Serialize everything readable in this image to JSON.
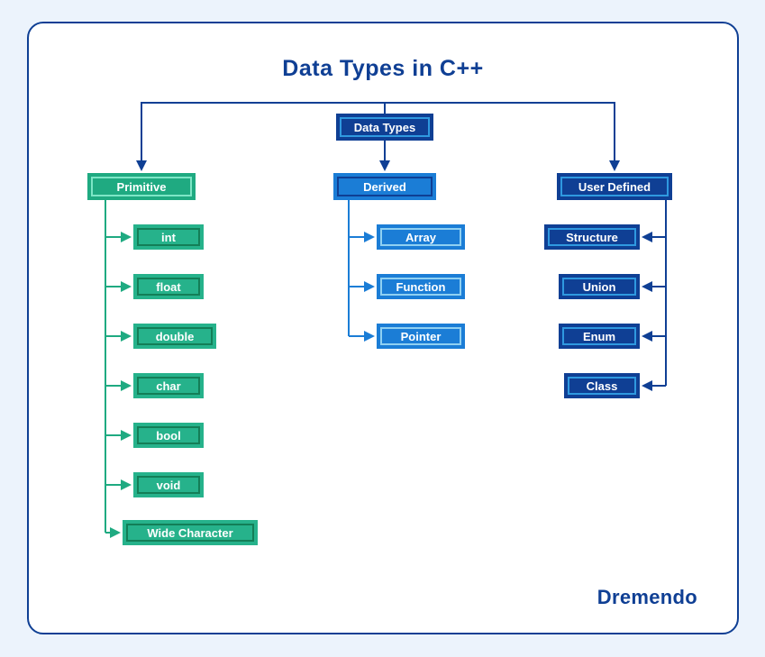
{
  "title": "Data Types in C++",
  "brand": "Dremendo",
  "root": {
    "label": "Data Types"
  },
  "primitive": {
    "label": "Primitive",
    "items": [
      "int",
      "float",
      "double",
      "char",
      "bool",
      "void",
      "Wide Character"
    ]
  },
  "derived": {
    "label": "Derived",
    "items": [
      "Array",
      "Function",
      "Pointer"
    ]
  },
  "userDefined": {
    "label": "User Defined",
    "items": [
      "Structure",
      "Union",
      "Enum",
      "Class"
    ]
  },
  "chart_data": {
    "type": "table",
    "title": "Data Types in C++",
    "root": "Data Types",
    "branches": [
      {
        "name": "Primitive",
        "children": [
          "int",
          "float",
          "double",
          "char",
          "bool",
          "void",
          "Wide Character"
        ]
      },
      {
        "name": "Derived",
        "children": [
          "Array",
          "Function",
          "Pointer"
        ]
      },
      {
        "name": "User Defined",
        "children": [
          "Structure",
          "Union",
          "Enum",
          "Class"
        ]
      }
    ]
  },
  "colors": {
    "background": "#ecf3fc",
    "frameBorder": "#0f3f94",
    "title": "#0f3f94",
    "primitive": "#1faa81",
    "primitiveChild": "#26b28b",
    "derived": "#1b7dd6",
    "userDefined": "#0f3f94"
  }
}
